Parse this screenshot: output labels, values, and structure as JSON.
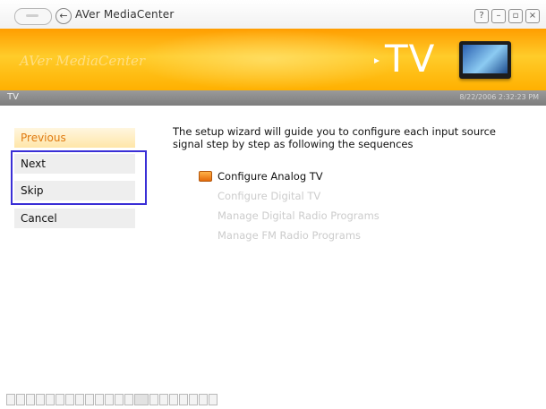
{
  "window": {
    "title": "AVer MediaCenter"
  },
  "banner": {
    "brand": "AVer MediaCenter",
    "section": "TV"
  },
  "infobar": {
    "left_label": "TV",
    "timestamp": "8/22/2006 2:32:23 PM"
  },
  "nav": {
    "previous": "Previous",
    "next": "Next",
    "skip": "Skip",
    "cancel": "Cancel"
  },
  "content": {
    "intro": "The setup wizard will guide you to configure each input source signal step by step as following the sequences",
    "steps": [
      {
        "label": "Configure Analog TV",
        "active": true
      },
      {
        "label": "Configure Digital TV",
        "active": false
      },
      {
        "label": "Manage Digital Radio Programs",
        "active": false
      },
      {
        "label": "Manage FM Radio Programs",
        "active": false
      }
    ]
  },
  "colors": {
    "banner_orange": "#ffb000",
    "previous_text": "#e07a10",
    "highlight_border": "#3a2fd6",
    "disabled_text": "#cccccc"
  },
  "icons": {
    "titlebar_nav": "back-arrow-icon",
    "step_active": "tv-step-icon",
    "banner_tv": "tv-set-icon"
  }
}
